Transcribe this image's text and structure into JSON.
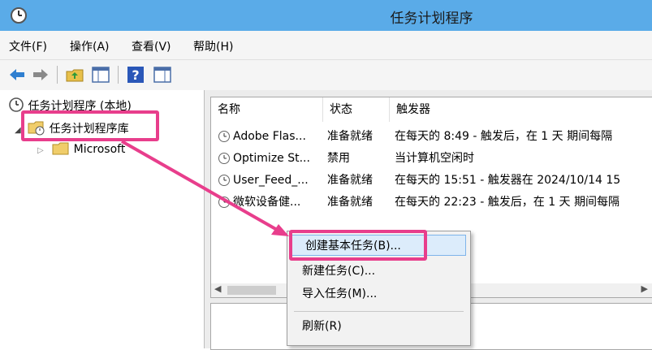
{
  "window": {
    "title": "任务计划程序"
  },
  "menu": [
    "文件(F)",
    "操作(A)",
    "查看(V)",
    "帮助(H)"
  ],
  "toolbar": {
    "icons": [
      "back-arrow-icon",
      "forward-arrow-icon",
      "folder-up-icon",
      "show-pane-icon",
      "help-icon",
      "action-pane-icon"
    ]
  },
  "tree": {
    "root": "任务计划程序 (本地)",
    "library": "任务计划程序库",
    "child": "Microsoft"
  },
  "list": {
    "columns": [
      "名称",
      "状态",
      "触发器"
    ],
    "rows": [
      {
        "name": "Adobe Flas...",
        "status": "准备就绪",
        "trigger": "在每天的 8:49 - 触发后，在 1 天 期间每隔"
      },
      {
        "name": "Optimize St...",
        "status": "禁用",
        "trigger": "当计算机空闲时"
      },
      {
        "name": "User_Feed_...",
        "status": "准备就绪",
        "trigger": "在每天的 15:51 - 触发器在 2024/10/14 15"
      },
      {
        "name": "微软设备健...",
        "status": "准备就绪",
        "trigger": "在每天的 22:23 - 触发后，在 1 天 期间每隔"
      }
    ]
  },
  "context_menu": {
    "items": [
      "创建基本任务(B)...",
      "新建任务(C)...",
      "导入任务(M)...",
      "刷新(R)"
    ]
  },
  "colors": {
    "titlebar": "#5aabe8",
    "annotation": "#e83e8c",
    "highlight": "#dcecfb"
  }
}
